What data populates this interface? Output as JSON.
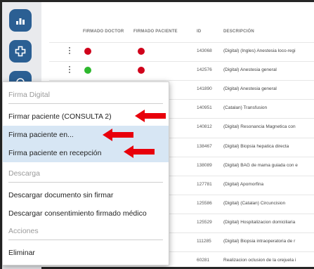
{
  "nav": {
    "buttons": [
      {
        "icon": "bar-chart-icon"
      },
      {
        "icon": "plus-cross-icon"
      },
      {
        "icon": "notes-icon"
      }
    ]
  },
  "table": {
    "columns": [
      "FIRMADO DOCTOR",
      "FIRMADO PACIENTE",
      "ID",
      "DESCRIPCIÓN"
    ],
    "rows": [
      {
        "doctor": "#d0021b",
        "paciente": "#d0021b",
        "id": "143068",
        "desc": "(Digital) (Ingles) Anestesia loco-regi"
      },
      {
        "doctor": "#2eb82e",
        "paciente": "#d0021b",
        "id": "142576",
        "desc": "(Digital) Anestesia general"
      },
      {
        "doctor": "",
        "paciente": "",
        "id": "141890",
        "desc": "(Digital) Anestesia general"
      },
      {
        "doctor": "",
        "paciente": "",
        "id": "140951",
        "desc": "(Catalan) Transfusion"
      },
      {
        "doctor": "",
        "paciente": "",
        "id": "140812",
        "desc": "(Digital) Resonancia Magnetica con"
      },
      {
        "doctor": "",
        "paciente": "",
        "id": "138467",
        "desc": "(Digital) Biopsia hepatica directa"
      },
      {
        "doctor": "",
        "paciente": "",
        "id": "138089",
        "desc": "(Digital) BAG de mama guiada con e"
      },
      {
        "doctor": "",
        "paciente": "",
        "id": "127781",
        "desc": "(Digital) Apomorfina"
      },
      {
        "doctor": "",
        "paciente": "",
        "id": "125586",
        "desc": "(Digital) (Catalan) Circuncision"
      },
      {
        "doctor": "",
        "paciente": "",
        "id": "125529",
        "desc": "(Digital) Hospitalizacion domiciliaria"
      },
      {
        "doctor": "",
        "paciente": "",
        "id": "111285",
        "desc": "(Digital) Biopsia intraoperatoria de r"
      },
      {
        "doctor": "",
        "paciente": "",
        "id": "60281",
        "desc": "Realizacion oclusion de la orejuela i"
      }
    ]
  },
  "menu": {
    "section_firma": "Firma Digital",
    "item_firmar": "Firmar paciente (CONSULTA 2)",
    "item_firma_en": "Firma paciente en...",
    "item_firma_recepcion": "Firma paciente en recepción",
    "section_descarga": "Descarga",
    "item_descargar_sin_firmar": "Descargar documento sin firmar",
    "item_descargar_consentimiento": "Descargar consentimiento firmado médico",
    "section_acciones": "Acciones",
    "item_eliminar": "Eliminar",
    "highlight_color": "#d7e6f4"
  },
  "annotation_arrow_color": "#e8000b"
}
